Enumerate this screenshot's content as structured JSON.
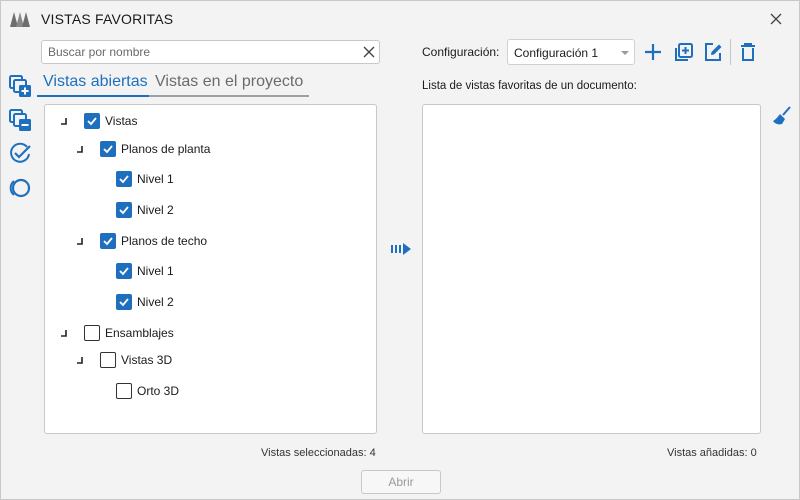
{
  "window": {
    "title": "VISTAS FAVORITAS",
    "accent_color": "#1f6fbf"
  },
  "search": {
    "placeholder": "Buscar por nombre",
    "value": ""
  },
  "left_toolbar": {
    "icons": [
      "add-views-icon",
      "remove-views-icon",
      "check-all-icon",
      "uncheck-all-icon"
    ]
  },
  "tabs": [
    {
      "label": "Vistas abiertas",
      "active": true
    },
    {
      "label": "Vistas en el proyecto",
      "active": false
    }
  ],
  "tree": [
    {
      "label": "Vistas",
      "checked": true,
      "depth": 0,
      "expander": true
    },
    {
      "label": "Planos de planta",
      "checked": true,
      "depth": 1,
      "expander": true
    },
    {
      "label": "Nivel 1",
      "checked": true,
      "depth": 2,
      "expander": false
    },
    {
      "label": "Nivel 2",
      "checked": true,
      "depth": 2,
      "expander": false
    },
    {
      "label": "Planos de techo",
      "checked": true,
      "depth": 1,
      "expander": true
    },
    {
      "label": "Nivel 1",
      "checked": true,
      "depth": 2,
      "expander": false
    },
    {
      "label": "Nivel 2",
      "checked": true,
      "depth": 2,
      "expander": false
    },
    {
      "label": "Ensamblajes",
      "checked": false,
      "depth": 0,
      "expander": true
    },
    {
      "label": "Vistas 3D",
      "checked": false,
      "depth": 1,
      "expander": true
    },
    {
      "label": "Orto 3D",
      "checked": false,
      "depth": 2,
      "expander": false
    }
  ],
  "status": {
    "selected": "Vistas seleccionadas: 4",
    "added": "Vistas añadidas: 0"
  },
  "config": {
    "label": "Configuración:",
    "selected": "Configuración 1"
  },
  "favorites": {
    "label": "Lista de vistas favoritas de un documento:",
    "items": []
  },
  "buttons": {
    "open": "Abrir"
  }
}
